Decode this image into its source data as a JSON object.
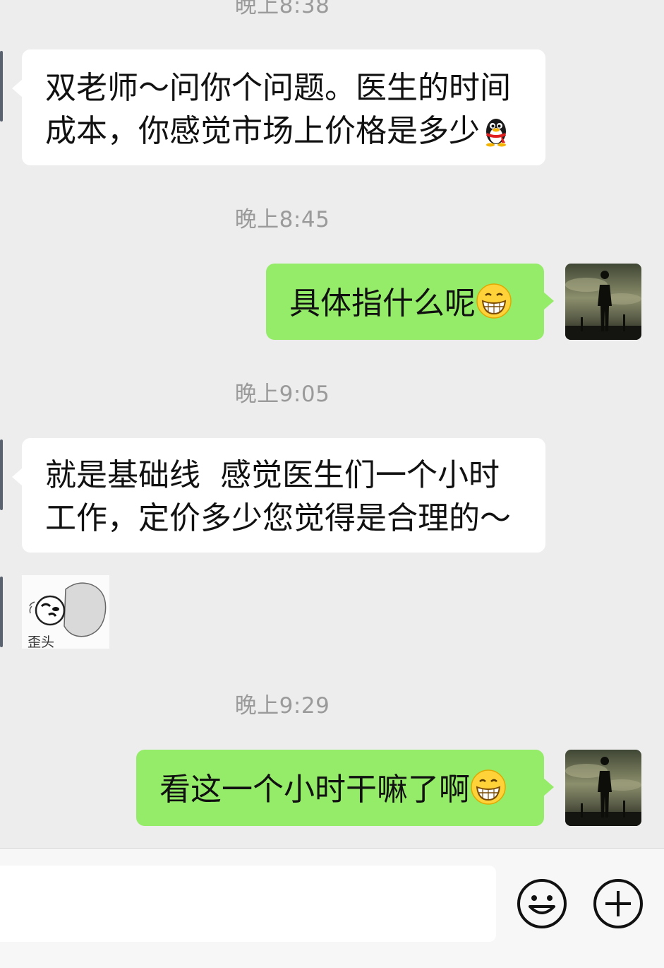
{
  "chat": {
    "messages": [
      {
        "type": "timestamp",
        "text": "晚上8:38"
      },
      {
        "type": "incoming",
        "text": "双老师～问你个问题。医生的时间成本，你感觉市场上价格是多少",
        "line1": "双老师～问你个问题。医生的时间",
        "line2": "成本，你感觉市场上价格是多少",
        "emoji": "qq-penguin-emoji"
      },
      {
        "type": "timestamp",
        "text": "晚上8:45"
      },
      {
        "type": "outgoing",
        "text": "具体指什么呢",
        "emoji": "grin-emoji"
      },
      {
        "type": "timestamp",
        "text": "晚上9:05"
      },
      {
        "type": "incoming",
        "text": "就是基础线  感觉医生们一个小时工作，定价多少您觉得是合理的～",
        "line1": "就是基础线  感觉医生们一个小时",
        "line2": "工作，定价多少您觉得是合理的～"
      },
      {
        "type": "sticker",
        "caption": "歪头",
        "icon": "tilted-head-penguin-sticker"
      },
      {
        "type": "timestamp",
        "text": "晚上9:29"
      },
      {
        "type": "outgoing",
        "text": "看这一个小时干嘛了啊",
        "emoji": "grin-emoji"
      }
    ]
  },
  "input_bar": {
    "emoji_button_icon": "smiley-icon",
    "more_button_icon": "plus-circle-icon",
    "input_value": ""
  },
  "colors": {
    "background": "#ededed",
    "incoming_bubble": "#ffffff",
    "outgoing_bubble": "#95ec69",
    "timestamp": "#9a9a9a"
  }
}
